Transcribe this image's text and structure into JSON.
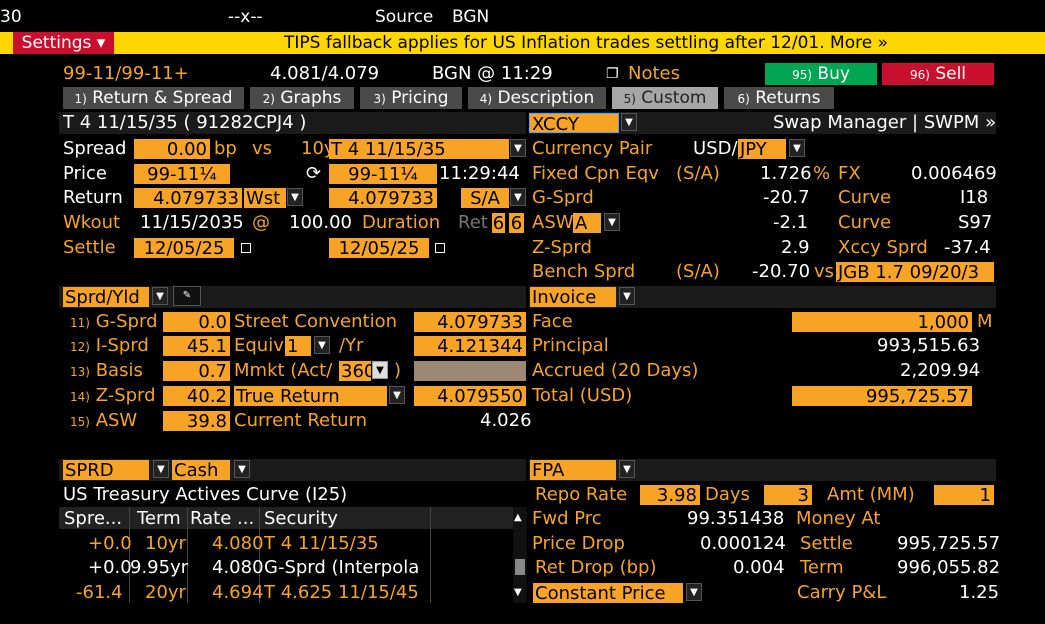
{
  "top": {
    "line1_a": "30",
    "line1_b": "--x--",
    "line1_c": "Source",
    "line1_d": "BGN"
  },
  "settings_bar": {
    "settings_label": "Settings ▾",
    "banner": "TIPS fallback applies for US Inflation trades settling after 12/01. More »"
  },
  "header": {
    "price_range": "99-11/99-11+",
    "yield_range": "4.081/4.079",
    "source_time": "BGN @ 11:29",
    "notes_label": "Notes",
    "buy_label": "Buy",
    "buy_num": "95)",
    "sell_label": "Sell",
    "sell_num": "96)"
  },
  "tabs": [
    {
      "num": "1)",
      "label": "Return & Spread"
    },
    {
      "num": "2)",
      "label": "Graphs"
    },
    {
      "num": "3)",
      "label": "Pricing"
    },
    {
      "num": "4)",
      "label": "Description"
    },
    {
      "num": "5)",
      "label": "Custom"
    },
    {
      "num": "6)",
      "label": "Returns"
    }
  ],
  "security": {
    "title": "T 4 11/15/35 ( 91282CPJ4 )",
    "spread_label": "Spread",
    "spread_value": "0.00",
    "spread_unit": "bp",
    "vs_label": "vs",
    "bench_tenor": "10y",
    "bench_security": "T 4 11/15/35",
    "price_label": "Price",
    "price_value": "99-11¼",
    "bench_price": "99-11¼",
    "price_time": "11:29:44",
    "return_label": "Return",
    "return_value": "4.079733",
    "return_type": "Wst",
    "bench_return": "4.079733",
    "freq": "S/A",
    "wkout_label": "Wkout",
    "wkout_date": "11/15/2035",
    "wkout_at": "@",
    "wkout_price": "100.00",
    "duration_label": "Duration",
    "ret_label": "Ret",
    "ret_a": "6",
    "ret_b": "6",
    "settle_label": "Settle",
    "settle_date": "12/05/25",
    "bench_settle": "12/05/25"
  },
  "xccy": {
    "selector": "XCCY",
    "swap_manager": "Swap Manager | SWPM »",
    "ccy_pair_label": "Currency Pair",
    "ccy_pair_a": "USD/",
    "ccy_pair_b": "JPY",
    "fixed_cpn_label": "Fixed Cpn Eqv",
    "fixed_cpn_freq": "(S/A)",
    "fixed_cpn_value": "1.726",
    "fixed_cpn_unit": "%",
    "fx_label": "FX",
    "fx_value": "0.006469",
    "gsprd_label": "G-Sprd",
    "gsprd_value": "-20.7",
    "curve1_label": "Curve",
    "curve1_value": "I18",
    "asw_label": "ASW",
    "asw_type": "A",
    "asw_value": "-2.1",
    "curve2_label": "Curve",
    "curve2_value": "S97",
    "zsprd_label": "Z-Sprd",
    "zsprd_value": "2.9",
    "xccy_sprd_label": "Xccy Sprd",
    "xccy_sprd_value": "-37.4",
    "bench_sprd_label": "Bench Sprd",
    "bench_sprd_freq": "(S/A)",
    "bench_sprd_value": "-20.70",
    "bench_vs": "vs",
    "bench_bond": "JGB 1.7 09/20/3"
  },
  "spreads": {
    "selector": "Sprd/Yld",
    "rows": [
      {
        "num": "11)",
        "label": "G-Sprd",
        "value": "0.0"
      },
      {
        "num": "12)",
        "label": "I-Sprd",
        "value": "45.1"
      },
      {
        "num": "13)",
        "label": "Basis",
        "value": "0.7"
      },
      {
        "num": "14)",
        "label": "Z-Sprd",
        "value": "40.2"
      },
      {
        "num": "15)",
        "label": "ASW",
        "value": "39.8"
      }
    ],
    "street_label": "Street Convention",
    "street_value": "4.079733",
    "equiv_label": "Equiv",
    "equiv_n": "1",
    "equiv_yr": "/Yr",
    "equiv_value": "4.121344",
    "mmkt_label": "Mmkt (Act/",
    "mmkt_days": "360",
    "mmkt_close": ")",
    "true_return_label": "True Return",
    "true_return_value": "4.079550",
    "current_return_label": "Current Return",
    "current_return_value": "4.026"
  },
  "invoice": {
    "selector": "Invoice",
    "face_label": "Face",
    "face_value": "1,000",
    "face_unit": "M",
    "principal_label": "Principal",
    "principal_value": "993,515.63",
    "accrued_label": "Accrued (20 Days)",
    "accrued_value": "2,209.94",
    "total_label": "Total (USD)",
    "total_value": "995,725.57"
  },
  "curve": {
    "selector_a": "SPRD",
    "selector_b": "Cash",
    "title": "US Treasury Actives Curve (I25)",
    "columns": [
      "Spre...",
      "Term",
      "Rate ...",
      "Security"
    ],
    "rows": [
      {
        "spread": "+0.0",
        "term": "10yr",
        "rate": "4.080",
        "security": "T 4 11/15/35"
      },
      {
        "spread": "+0.0",
        "term": "9.95yr",
        "rate": "4.080",
        "security": "G-Sprd (Interpola"
      },
      {
        "spread": "-61.4",
        "term": "20yr",
        "rate": "4.694",
        "security": "T 4.625 11/15/45"
      }
    ]
  },
  "fpa": {
    "selector": "FPA",
    "repo_label": "Repo Rate",
    "repo_value": "3.98",
    "days_label": "Days",
    "days_value": "3",
    "amt_label": "Amt (MM)",
    "amt_value": "1",
    "fwd_prc_label": "Fwd Prc",
    "fwd_prc_value": "99.351438",
    "money_at_label": "Money At",
    "price_drop_label": "Price Drop",
    "price_drop_value": "0.000124",
    "settle_label": "Settle",
    "settle_value": "995,725.57",
    "ret_drop_label": "Ret Drop (bp)",
    "ret_drop_value": "0.004",
    "term_label": "Term",
    "term_value": "996,055.82",
    "constant_label": "Constant Price",
    "carry_label": "Carry P&L",
    "carry_value": "1.25"
  }
}
